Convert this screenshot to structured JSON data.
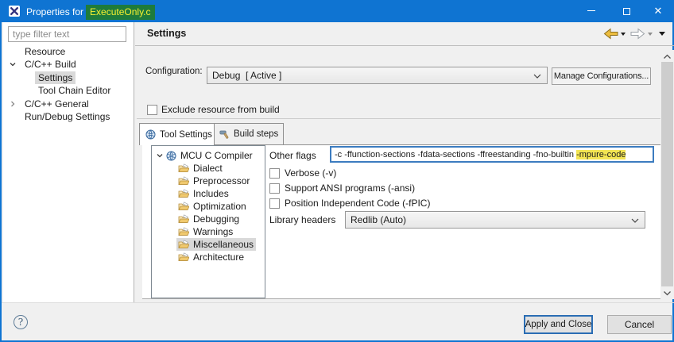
{
  "window": {
    "title_prefix": "Properties for",
    "title_file": "ExecuteOnly.c"
  },
  "colors": {
    "titlebar_blue": "#0f74d2",
    "filename_highlight_green": "#1e7b3c",
    "filename_text_yellow": "#f5ef30",
    "flag_highlight_yellow": "#f3e553"
  },
  "sidebar": {
    "filter_placeholder": "type filter text",
    "tree": [
      {
        "label": "Resource"
      },
      {
        "label": "C/C++ Build",
        "state": "expanded"
      },
      {
        "label": "Settings",
        "selected": true
      },
      {
        "label": "Tool Chain Editor"
      },
      {
        "label": "C/C++ General",
        "state": "collapsed"
      },
      {
        "label": "Run/Debug Settings"
      }
    ]
  },
  "header": {
    "title": "Settings"
  },
  "configuration": {
    "label": "Configuration:",
    "value": "Debug  [ Active ]",
    "manage_button": "Manage Configurations..."
  },
  "exclude_build": {
    "label": "Exclude resource from build",
    "checked": false
  },
  "tabs": [
    {
      "label": "Tool Settings",
      "active": true
    },
    {
      "label": "Build steps",
      "active": false
    }
  ],
  "tool_tree": {
    "root": "MCU C Compiler",
    "children": [
      "Dialect",
      "Preprocessor",
      "Includes",
      "Optimization",
      "Debugging",
      "Warnings",
      "Miscellaneous",
      "Architecture"
    ],
    "selected": "Miscellaneous"
  },
  "settings_fields": {
    "other_flags_label": "Other flags",
    "other_flags_prefix": "-c -ffunction-sections -fdata-sections -ffreestanding -fno-builtin ",
    "other_flags_highlighted": "-mpure-code",
    "verbose": {
      "label": "Verbose (-v)",
      "checked": false
    },
    "ansi": {
      "label": "Support ANSI programs (-ansi)",
      "checked": false
    },
    "fpic": {
      "label": "Position Independent Code (-fPIC)",
      "checked": false
    },
    "library_headers_label": "Library headers",
    "library_headers_value": "Redlib (Auto)"
  },
  "footer": {
    "apply_button": "Apply and Close",
    "cancel_button": "Cancel"
  }
}
